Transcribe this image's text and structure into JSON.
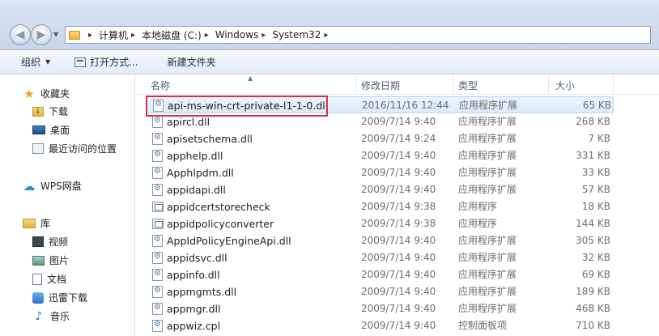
{
  "address": {
    "breadcrumbs": [
      "计算机",
      "本地磁盘 (C:)",
      "Windows",
      "System32"
    ]
  },
  "toolbar": {
    "organize": "组织",
    "open_with": "打开方式...",
    "new_folder": "新建文件夹"
  },
  "nav": {
    "favorites": "收藏夹",
    "downloads": "下载",
    "desktop": "桌面",
    "recent": "最近访问的位置",
    "wps": "WPS网盘",
    "libraries": "库",
    "videos": "视频",
    "pictures": "图片",
    "documents": "文档",
    "xunlei": "迅雷下载",
    "music": "音乐"
  },
  "columns": {
    "name": "名称",
    "date": "修改日期",
    "type": "类型",
    "size": "大小"
  },
  "files": [
    {
      "name": "api-ms-win-crt-private-l1-1-0.dll",
      "date": "2016/11/16 12:44",
      "type": "应用程序扩展",
      "size": "65 KB",
      "icon": "dll"
    },
    {
      "name": "apircl.dll",
      "date": "2009/7/14 9:40",
      "type": "应用程序扩展",
      "size": "268 KB",
      "icon": "dll"
    },
    {
      "name": "apisetschema.dll",
      "date": "2009/7/14 9:24",
      "type": "应用程序扩展",
      "size": "7 KB",
      "icon": "dll"
    },
    {
      "name": "apphelp.dll",
      "date": "2009/7/14 9:40",
      "type": "应用程序扩展",
      "size": "331 KB",
      "icon": "dll"
    },
    {
      "name": "Apphlpdm.dll",
      "date": "2009/7/14 9:40",
      "type": "应用程序扩展",
      "size": "33 KB",
      "icon": "dll"
    },
    {
      "name": "appidapi.dll",
      "date": "2009/7/14 9:40",
      "type": "应用程序扩展",
      "size": "57 KB",
      "icon": "dll"
    },
    {
      "name": "appidcertstorecheck",
      "date": "2009/7/14 9:38",
      "type": "应用程序",
      "size": "18 KB",
      "icon": "exe"
    },
    {
      "name": "appidpolicyconverter",
      "date": "2009/7/14 9:38",
      "type": "应用程序",
      "size": "144 KB",
      "icon": "exe"
    },
    {
      "name": "AppIdPolicyEngineApi.dll",
      "date": "2009/7/14 9:40",
      "type": "应用程序扩展",
      "size": "305 KB",
      "icon": "dll"
    },
    {
      "name": "appidsvc.dll",
      "date": "2009/7/14 9:40",
      "type": "应用程序扩展",
      "size": "32 KB",
      "icon": "dll"
    },
    {
      "name": "appinfo.dll",
      "date": "2009/7/14 9:40",
      "type": "应用程序扩展",
      "size": "69 KB",
      "icon": "dll"
    },
    {
      "name": "appmgmts.dll",
      "date": "2009/7/14 9:40",
      "type": "应用程序扩展",
      "size": "189 KB",
      "icon": "dll"
    },
    {
      "name": "appmgr.dll",
      "date": "2009/7/14 9:40",
      "type": "应用程序扩展",
      "size": "468 KB",
      "icon": "dll"
    },
    {
      "name": "appwiz.cpl",
      "date": "2009/7/14 9:40",
      "type": "控制面板项",
      "size": "710 KB",
      "icon": "cpl"
    }
  ]
}
